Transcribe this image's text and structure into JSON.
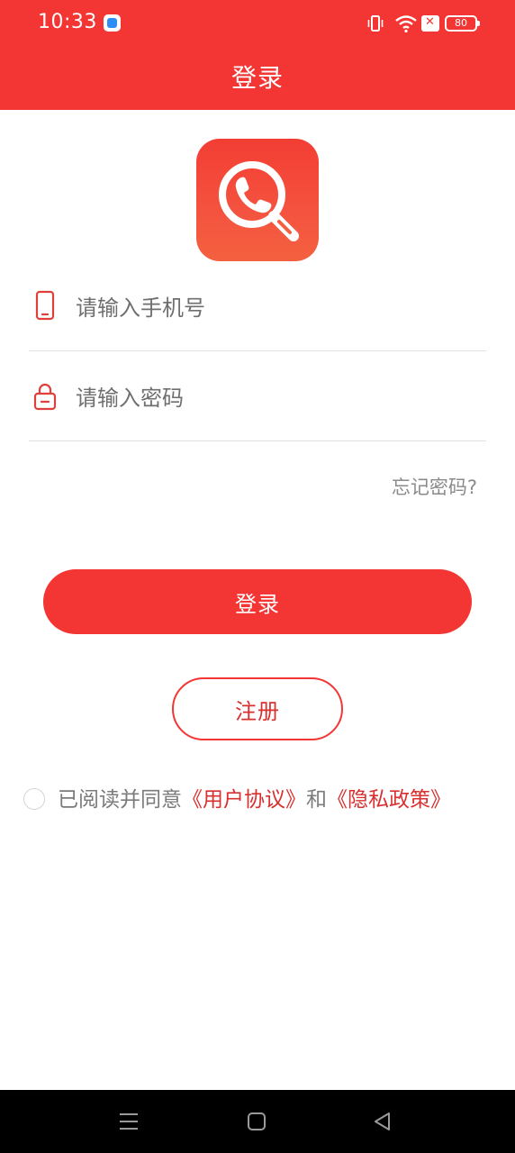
{
  "status_bar": {
    "time": "10:33",
    "battery": "80",
    "icons": [
      "app-notification-icon",
      "vibrate-icon",
      "wifi-icon",
      "no-sim-icon",
      "battery-icon"
    ]
  },
  "header": {
    "title": "登录"
  },
  "logo": {
    "icon": "phone-search-icon"
  },
  "form": {
    "phone": {
      "placeholder": "请输入手机号",
      "value": "",
      "icon": "phone-icon"
    },
    "password": {
      "placeholder": "请输入密码",
      "value": "",
      "icon": "lock-icon"
    },
    "forgot_label": "忘记密码?"
  },
  "buttons": {
    "login_label": "登录",
    "register_label": "注册"
  },
  "agreement": {
    "prefix": "已阅读并同意",
    "user_agreement": "《用户协议》",
    "and": "和",
    "privacy_policy": "《隐私政策》",
    "checked": false
  },
  "colors": {
    "primary": "#f33634",
    "link": "#d8302e",
    "muted": "#7b7b7b",
    "divider": "#e3e3e3"
  },
  "nav": {
    "icons": [
      "menu-icon",
      "home-icon",
      "back-icon"
    ]
  }
}
